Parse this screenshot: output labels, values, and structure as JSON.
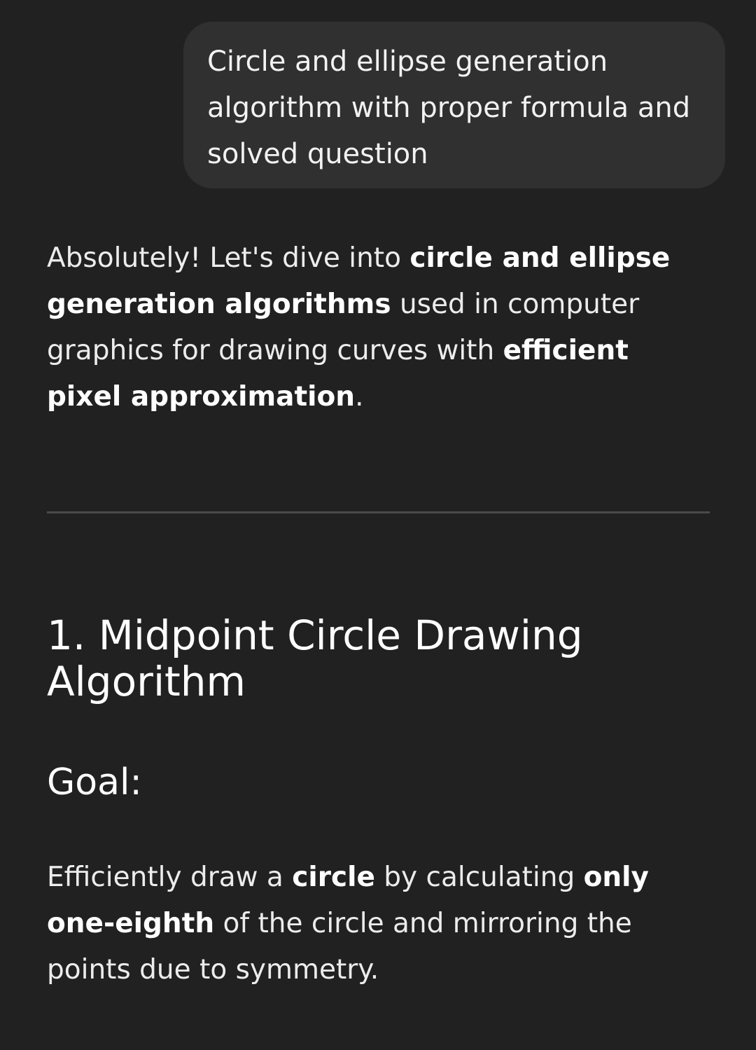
{
  "user_message": {
    "text": "Circle and ellipse generation algorithm with proper formula and solved question"
  },
  "assistant": {
    "intro": {
      "t1": "Absolutely! Let's dive into ",
      "b1": "circle and ellipse generation algorithms",
      "t2": " used in computer graphics for drawing curves with ",
      "b2": "efficient pixel approximation",
      "t3": "."
    },
    "section1": {
      "title": "1. Midpoint Circle Drawing Algorithm",
      "goal_heading": "Goal:",
      "goal": {
        "t1": "Efficiently draw a ",
        "b1": "circle",
        "t2": " by calculating ",
        "b2": "only one-eighth",
        "t3": " of the circle and mirroring the points due to symmetry."
      }
    }
  }
}
